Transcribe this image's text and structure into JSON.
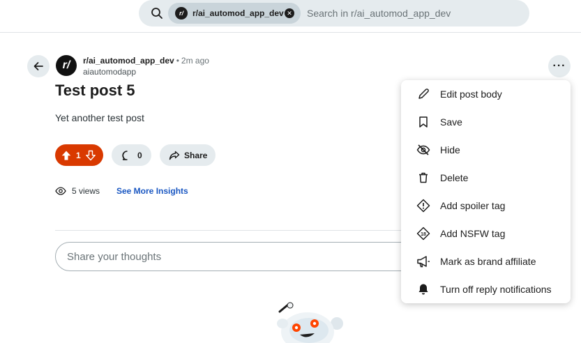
{
  "search": {
    "chip_label": "r/ai_automod_app_dev",
    "chip_avatar": "r/",
    "placeholder": "Search in r/ai_automod_app_dev"
  },
  "post": {
    "subreddit_avatar": "r/",
    "subreddit": "r/ai_automod_app_dev",
    "separator": "•",
    "time": "2m ago",
    "author": "aiautomodapp",
    "title": "Test post 5",
    "body": "Yet another test post",
    "vote_count": "1",
    "comment_count": "0",
    "share_label": "Share",
    "views": "5 views",
    "insights_label": "See More Insights"
  },
  "comment_box": {
    "placeholder": "Share your thoughts"
  },
  "more_button": "···",
  "menu": {
    "items": [
      {
        "label": "Edit post body",
        "icon": "pencil-icon"
      },
      {
        "label": "Save",
        "icon": "bookmark-icon"
      },
      {
        "label": "Hide",
        "icon": "eye-slash-icon"
      },
      {
        "label": "Delete",
        "icon": "trash-icon"
      },
      {
        "label": "Add spoiler tag",
        "icon": "spoiler-icon"
      },
      {
        "label": "Add NSFW tag",
        "icon": "nsfw-icon"
      },
      {
        "label": "Mark as brand affiliate",
        "icon": "megaphone-icon"
      },
      {
        "label": "Turn off reply notifications",
        "icon": "bell-icon"
      }
    ]
  },
  "colors": {
    "upvote_active": "#d93900",
    "link": "#1a57c2",
    "pill_bg": "#e5ebee"
  }
}
